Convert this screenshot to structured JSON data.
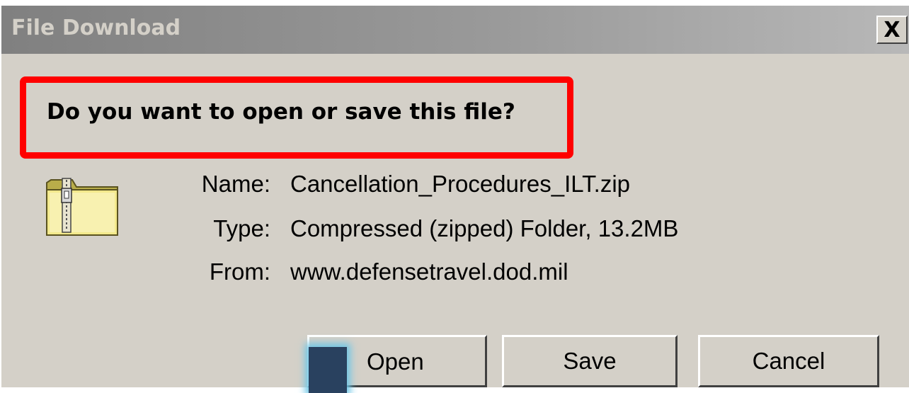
{
  "window": {
    "title": "File Download",
    "close_label": "X"
  },
  "prompt": {
    "question": "Do you want to open or save this file?",
    "highlight_color": "#ff0000"
  },
  "file": {
    "icon": "zip-folder-icon",
    "name_label": "Name:",
    "name_value": "Cancellation_Procedures_ILT.zip",
    "type_label": "Type:",
    "type_value": "Compressed (zipped) Folder, 13.2MB",
    "from_label": "From:",
    "from_value": "www.defensetravel.dod.mil"
  },
  "buttons": {
    "open_label": "Open",
    "save_label": "Save",
    "cancel_label": "Cancel"
  }
}
